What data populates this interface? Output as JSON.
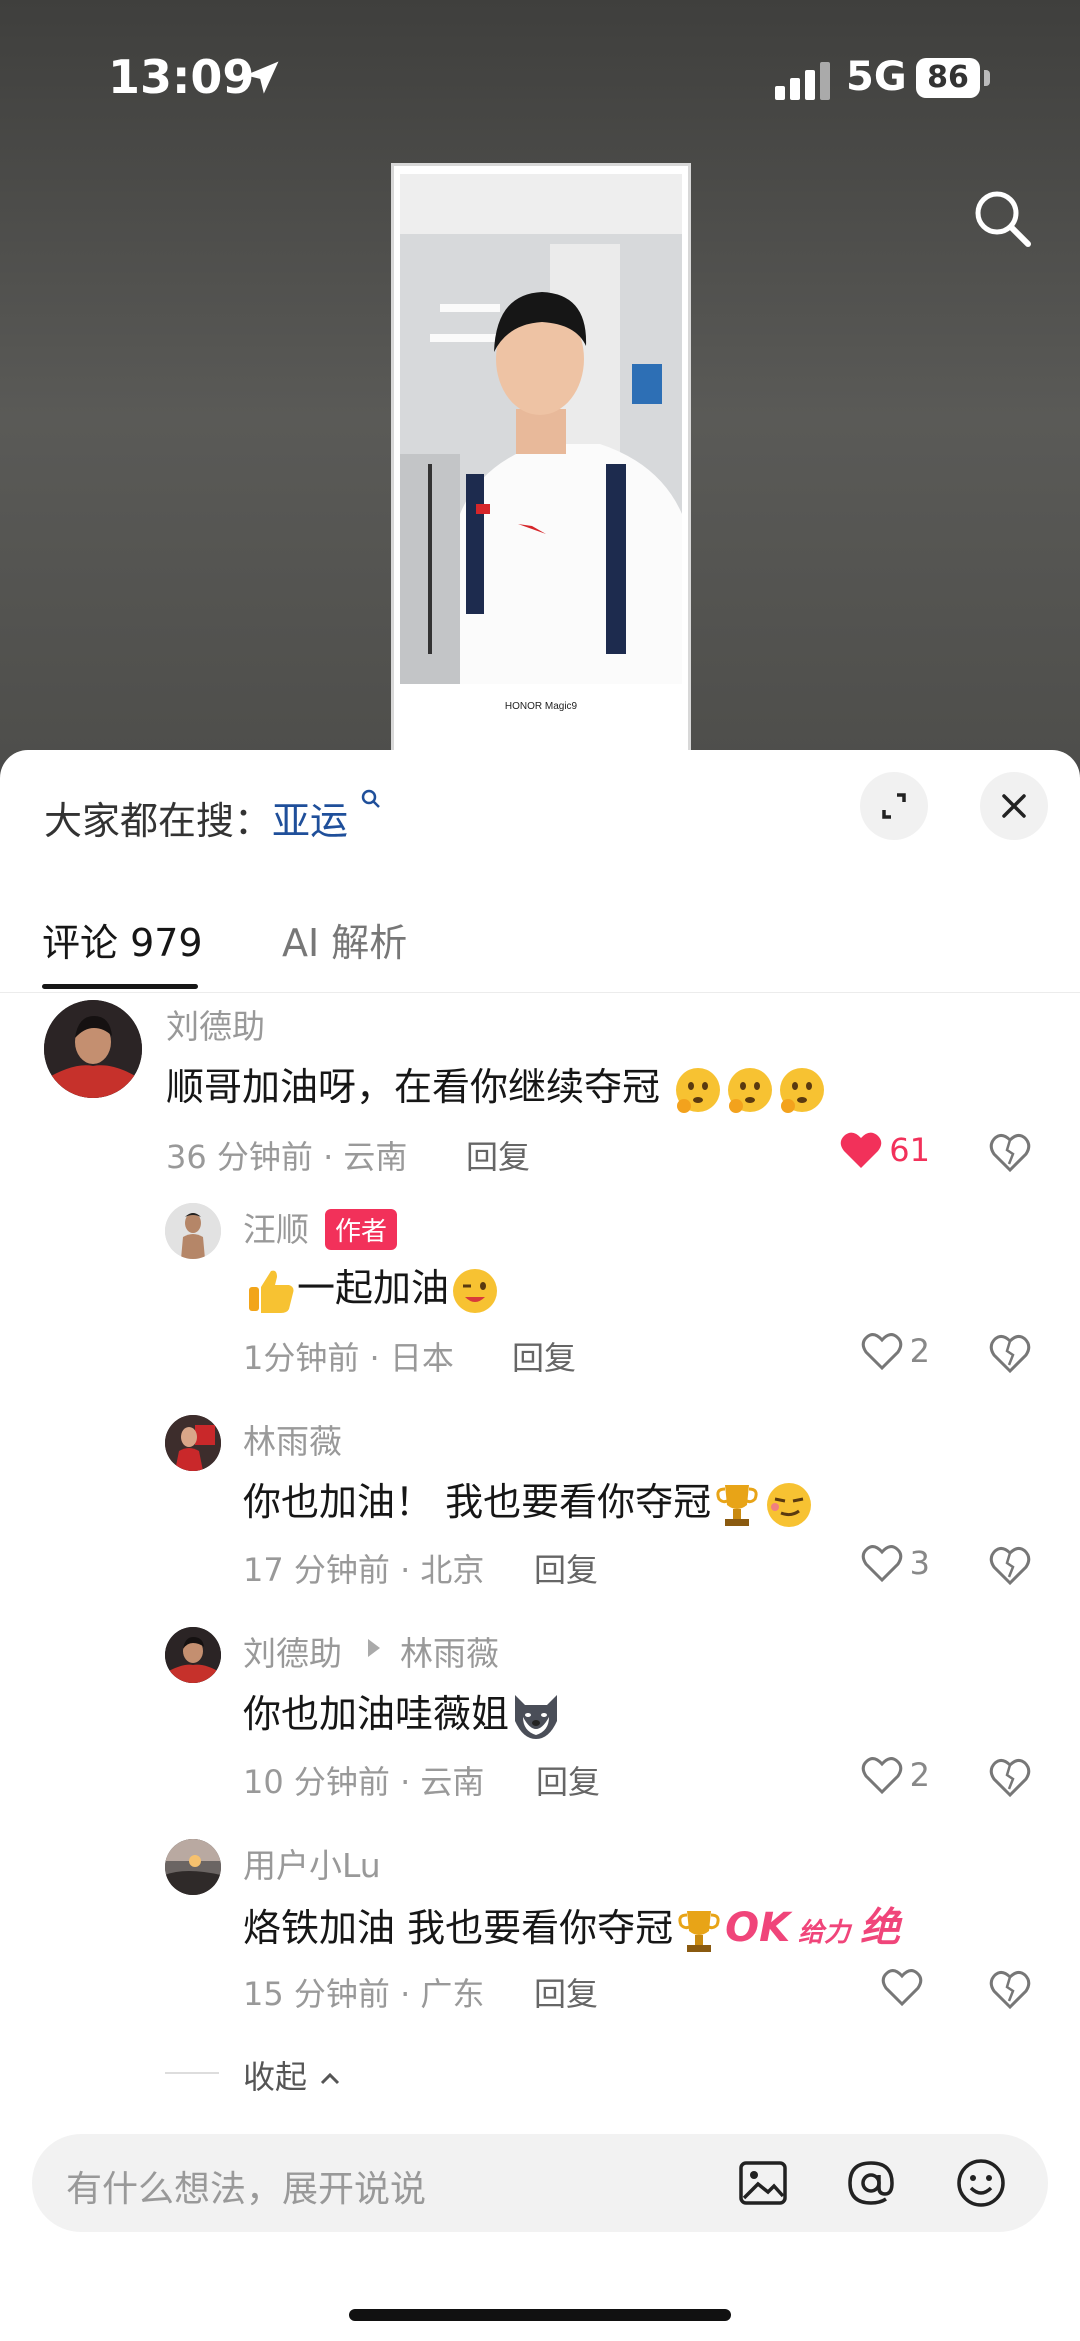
{
  "status": {
    "time": "13:09",
    "network": "5G",
    "battery": "86"
  },
  "video": {
    "caption": "HONOR Magic9"
  },
  "hot_search": {
    "prefix": "大家都在搜：",
    "keyword": "亚运"
  },
  "tabs": [
    {
      "label": "评论 979"
    },
    {
      "label": "AI 解析"
    }
  ],
  "comments": [
    {
      "user": "刘德助",
      "text": "顺哥加油呀，在看你继续夺冠",
      "meta": "36 分钟前 · 云南",
      "reply": "回复",
      "likes": "61",
      "liked": true
    },
    {
      "user": "汪顺",
      "badge": "作者",
      "text": "一起加油",
      "meta": "1分钟前 · 日本",
      "reply": "回复",
      "likes": "2"
    },
    {
      "user": "林雨薇",
      "text": "你也加油！ 我也要看你夺冠",
      "meta": "17 分钟前 · 北京",
      "reply": "回复",
      "likes": "3"
    },
    {
      "user": "刘德助",
      "reply_to": "林雨薇",
      "text": "你也加油哇薇姐",
      "meta": "10 分钟前 · 云南",
      "reply": "回复",
      "likes": "2"
    },
    {
      "user": "用户小Lu",
      "text": "烙铁加油 我也要看你夺冠",
      "sticker_ok": "OK",
      "sticker_geili": "给力",
      "sticker_jue": "绝",
      "meta": "15 分钟前 · 广东",
      "reply": "回复",
      "likes": ""
    }
  ],
  "collapse_label": "收起",
  "input": {
    "placeholder": "有什么想法，展开说说"
  },
  "colors": {
    "like_red": "#f2315a",
    "keyword_blue": "#1f4f9a",
    "badge_red": "#f2315a"
  },
  "icons": [
    "location-arrow-icon",
    "search-icon",
    "expand-icon",
    "close-icon",
    "heart-icon",
    "dislike-heart-icon",
    "image-icon",
    "at-icon",
    "emoji-icon",
    "chevron-up-icon"
  ]
}
